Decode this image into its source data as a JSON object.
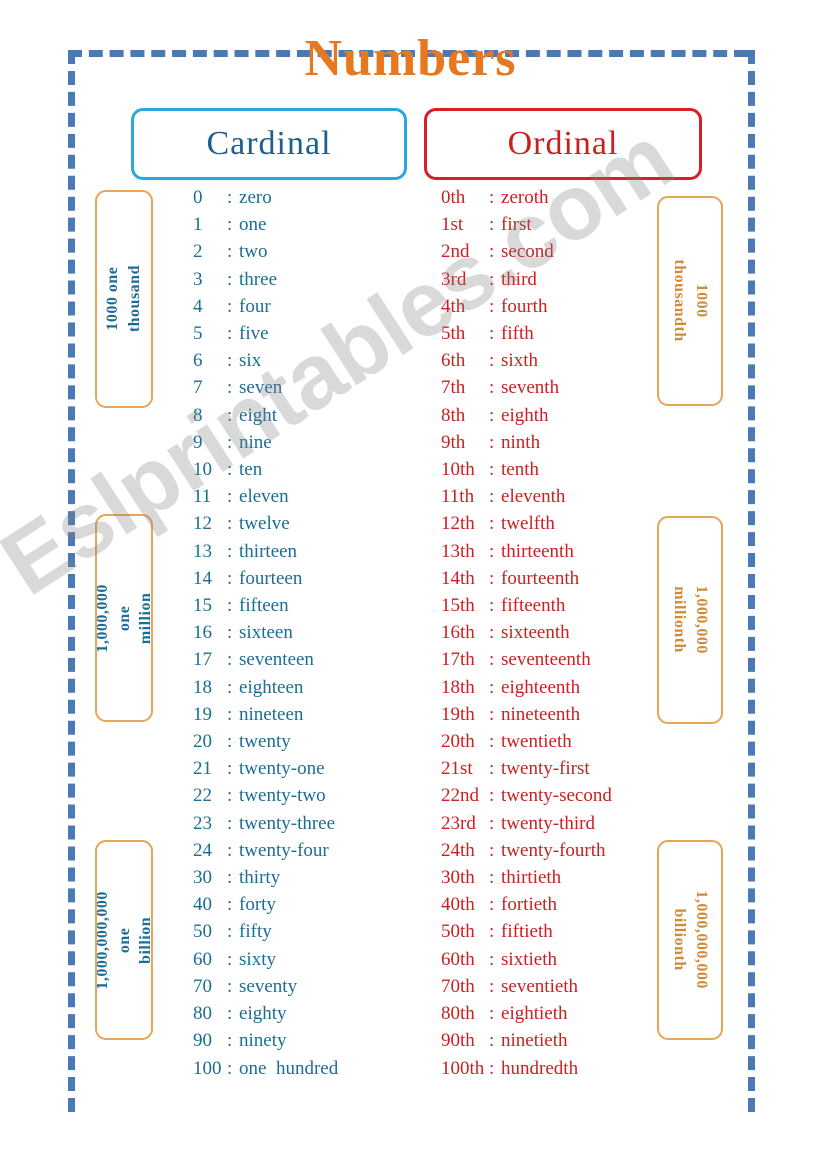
{
  "title": "Numbers",
  "watermark": "Eslprintables.com",
  "headings": {
    "cardinal": "Cardinal",
    "ordinal": "Ordinal"
  },
  "cardinal_rows": [
    {
      "num": "0",
      "sep": ":",
      "word": "zero"
    },
    {
      "num": "1",
      "sep": ":",
      "word": "one"
    },
    {
      "num": "2",
      "sep": ":",
      "word": "two"
    },
    {
      "num": "3",
      "sep": ":",
      "word": "three"
    },
    {
      "num": "4",
      "sep": ":",
      "word": "four"
    },
    {
      "num": "5",
      "sep": ":",
      "word": "five"
    },
    {
      "num": "6",
      "sep": ":",
      "word": "six"
    },
    {
      "num": "7",
      "sep": ":",
      "word": "seven"
    },
    {
      "num": "8",
      "sep": ":",
      "word": "eight"
    },
    {
      "num": "9",
      "sep": ":",
      "word": "nine"
    },
    {
      "num": "10",
      "sep": ":",
      "word": "ten"
    },
    {
      "num": "11",
      "sep": ":",
      "word": "eleven"
    },
    {
      "num": "12",
      "sep": ":",
      "word": "twelve"
    },
    {
      "num": "13",
      "sep": ":",
      "word": "thirteen"
    },
    {
      "num": "14",
      "sep": ":",
      "word": "fourteen"
    },
    {
      "num": "15",
      "sep": ":",
      "word": "fifteen"
    },
    {
      "num": "16",
      "sep": ":",
      "word": "sixteen"
    },
    {
      "num": "17",
      "sep": ":",
      "word": "seventeen"
    },
    {
      "num": "18",
      "sep": ":",
      "word": "eighteen"
    },
    {
      "num": "19",
      "sep": ":",
      "word": "nineteen"
    },
    {
      "num": "20",
      "sep": ":",
      "word": "twenty"
    },
    {
      "num": "21",
      "sep": ":",
      "word": "twenty-one"
    },
    {
      "num": "22",
      "sep": ":",
      "word": "twenty-two"
    },
    {
      "num": "23",
      "sep": ":",
      "word": "twenty-three"
    },
    {
      "num": "24",
      "sep": ":",
      "word": "twenty-four"
    },
    {
      "num": "30",
      "sep": ":",
      "word": "thirty"
    },
    {
      "num": "40",
      "sep": ":",
      "word": "forty"
    },
    {
      "num": "50",
      "sep": ":",
      "word": "fifty"
    },
    {
      "num": "60",
      "sep": ":",
      "word": "sixty"
    },
    {
      "num": "70",
      "sep": ":",
      "word": "seventy"
    },
    {
      "num": "80",
      "sep": ":",
      "word": "eighty"
    },
    {
      "num": "90",
      "sep": ":",
      "word": "ninety"
    },
    {
      "num": "100",
      "sep": ":",
      "word": "one  hundred"
    }
  ],
  "ordinal_rows": [
    {
      "num": "0th",
      "sep": ":",
      "word": "zeroth"
    },
    {
      "num": "1st",
      "sep": ":",
      "word": "first"
    },
    {
      "num": "2nd",
      "sep": ":",
      "word": "second"
    },
    {
      "num": "3rd",
      "sep": ":",
      "word": "third"
    },
    {
      "num": "4th",
      "sep": ":",
      "word": "fourth"
    },
    {
      "num": "5th",
      "sep": ":",
      "word": "fifth"
    },
    {
      "num": "6th",
      "sep": ":",
      "word": "sixth"
    },
    {
      "num": "7th",
      "sep": ":",
      "word": "seventh"
    },
    {
      "num": "8th",
      "sep": ":",
      "word": "eighth"
    },
    {
      "num": "9th",
      "sep": ":",
      "word": "ninth"
    },
    {
      "num": "10th",
      "sep": ":",
      "word": "tenth"
    },
    {
      "num": "11th",
      "sep": ":",
      "word": "eleventh"
    },
    {
      "num": "12th",
      "sep": ":",
      "word": "twelfth"
    },
    {
      "num": "13th",
      "sep": ":",
      "word": "thirteenth"
    },
    {
      "num": "14th",
      "sep": ":",
      "word": "fourteenth"
    },
    {
      "num": "15th",
      "sep": ":",
      "word": "fifteenth"
    },
    {
      "num": "16th",
      "sep": ":",
      "word": "sixteenth"
    },
    {
      "num": "17th",
      "sep": ":",
      "word": "seventeenth"
    },
    {
      "num": "18th",
      "sep": ":",
      "word": "eighteenth"
    },
    {
      "num": "19th",
      "sep": ":",
      "word": "nineteenth"
    },
    {
      "num": "20th",
      "sep": ":",
      "word": "twentieth"
    },
    {
      "num": "21st",
      "sep": ":",
      "word": "twenty-first"
    },
    {
      "num": "22nd",
      "sep": ":",
      "word": "twenty-second"
    },
    {
      "num": "23rd",
      "sep": ":",
      "word": "twenty-third"
    },
    {
      "num": "24th",
      "sep": ":",
      "word": "twenty-fourth"
    },
    {
      "num": "30th",
      "sep": ":",
      "word": "thirtieth"
    },
    {
      "num": "40th",
      "sep": ":",
      "word": "fortieth"
    },
    {
      "num": "50th",
      "sep": ":",
      "word": "fiftieth"
    },
    {
      "num": "60th",
      "sep": ":",
      "word": "sixtieth"
    },
    {
      "num": "70th",
      "sep": ":",
      "word": "seventieth"
    },
    {
      "num": "80th",
      "sep": ":",
      "word": "eightieth"
    },
    {
      "num": "90th",
      "sep": ":",
      "word": "ninetieth"
    },
    {
      "num": "100th",
      "sep": ":",
      "word": "hundredth"
    }
  ],
  "side_boxes": {
    "left": [
      {
        "text": "1000 one  thousand"
      },
      {
        "text": "1,000,000  one\nmillion"
      },
      {
        "text": "1,000,000,000  one\nbillion"
      }
    ],
    "right": [
      {
        "text": "1000 thousandth"
      },
      {
        "text": "1,000,000  millionth"
      },
      {
        "text": "1,000,000,000\nbillionth"
      }
    ]
  },
  "colors": {
    "title": "#e8781f",
    "frame": "#4a7ab5",
    "cardinal_border": "#29a8dd",
    "cardinal_heading_text": "#1f5f8f",
    "cardinal_text": "#1b6d96",
    "ordinal_border": "#d81f26",
    "ordinal_text": "#cb1f20",
    "side_box_border": "#e8a457",
    "side_right_text": "#d08a37"
  }
}
